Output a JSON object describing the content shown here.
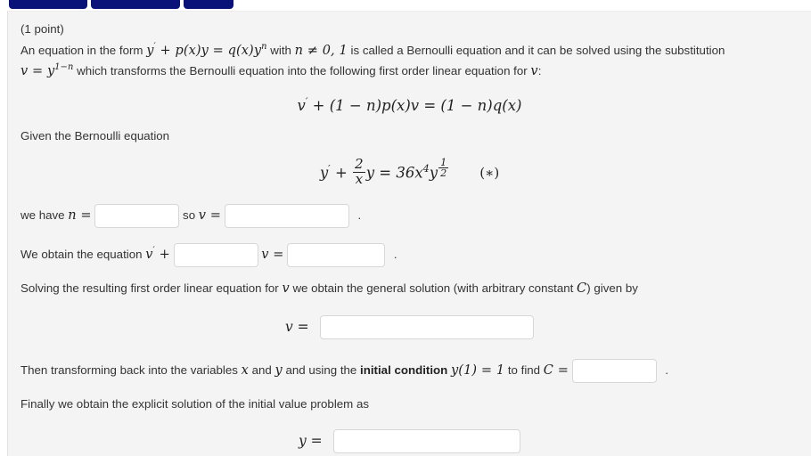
{
  "nav": {
    "buttons": [
      {
        "label": ""
      },
      {
        "label": ""
      },
      {
        "label": ""
      }
    ],
    "color": "#081278"
  },
  "problem": {
    "points": "(1 point)",
    "intro_part1": "An equation in the form",
    "intro_eq1": "y' + p(x)y = q(x)yⁿ",
    "intro_part2": "with",
    "intro_eq2": "n ≠ 0, 1",
    "intro_part3": "is called a Bernoulli equation and it can be solved using the substitution",
    "substitution": "v = y¹⁻ⁿ",
    "intro_part4": "which transforms the Bernoulli equation into the following first order linear equation for",
    "intro_var": "v",
    "intro_colon": ":",
    "linear_equation": "v' + (1 − n)p(x)v = (1 − n)q(x)",
    "given_label": "Given the Bernoulli equation",
    "bernoulli_equation": "y' + (2/x)y = 36x⁴y^(1/2)",
    "bernoulli_star": "(∗)",
    "row_n": {
      "prefix": "we have",
      "var_n": "n =",
      "n_value": "",
      "middle": "so",
      "var_v": "v =",
      "v_value": "",
      "suffix": "."
    },
    "row_equation": {
      "prefix": "We obtain the equation",
      "vprime_plus": "v' +",
      "coefficient_value": "",
      "var_v_eq": "v =",
      "rhs_value": "",
      "suffix": "."
    },
    "solving_text_a": "Solving the resulting first order linear equation for",
    "solving_var": "v",
    "solving_text_b": "we obtain the general solution (with arbitrary constant",
    "solving_const": "C",
    "solving_text_c": ") given by",
    "v_answer": {
      "label": "v =",
      "value": ""
    },
    "transform_text_a": "Then transforming back into the variables",
    "transform_var_x": "x",
    "transform_and": "and",
    "transform_var_y": "y",
    "transform_text_b": "and using the",
    "initial_condition_label": "initial condition",
    "initial_condition_eq": "y(1) = 1",
    "transform_text_c": "to find",
    "transform_const": "C =",
    "C_value": "",
    "transform_suffix": ".",
    "final_text": "Finally we obtain the explicit solution of the initial value problem as",
    "y_answer": {
      "label": "y =",
      "value": ""
    }
  }
}
